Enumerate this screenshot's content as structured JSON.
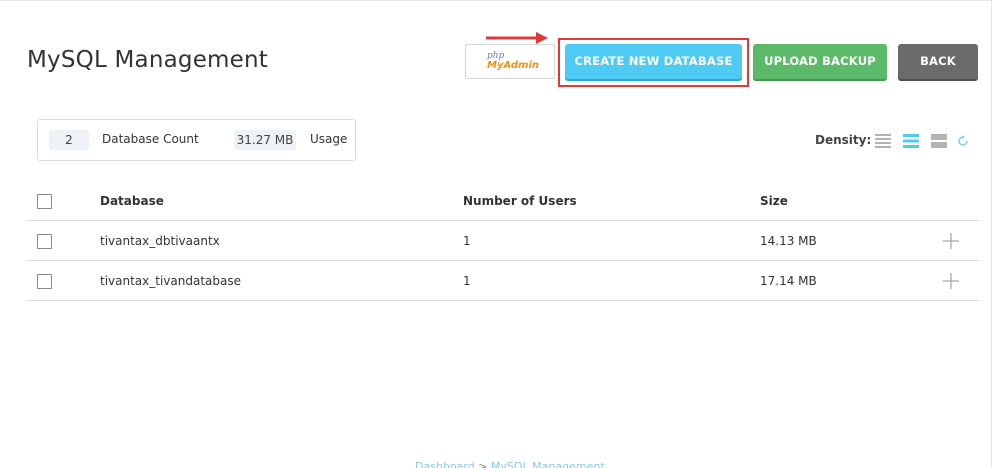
{
  "page": {
    "title": "MySQL Management"
  },
  "toolbar": {
    "pma_php": "php",
    "pma_myadmin": "MyAdmin",
    "create_label": "CREATE NEW DATABASE",
    "upload_label": "UPLOAD BACKUP",
    "back_label": "BACK"
  },
  "stats": {
    "count_value": "2",
    "count_label": "Database Count",
    "usage_value": "31.27 MB",
    "usage_label": "Usage"
  },
  "density": {
    "label": "Density:"
  },
  "table": {
    "headers": {
      "database": "Database",
      "users": "Number of Users",
      "size": "Size"
    },
    "rows": [
      {
        "database": "tivantax_dbtivaantx",
        "users": "1",
        "size": "14.13 MB"
      },
      {
        "database": "tivantax_tivandatabase",
        "users": "1",
        "size": "17.14 MB"
      }
    ]
  },
  "breadcrumb": {
    "home": "Dashboard",
    "separator": ">",
    "current": "MySQL Management"
  },
  "colors": {
    "create": "#4fcbf3",
    "upload": "#5cba6a",
    "back": "#6b6b6b",
    "annotation": "#dc3b3b",
    "density_active": "#4fcbf3"
  }
}
